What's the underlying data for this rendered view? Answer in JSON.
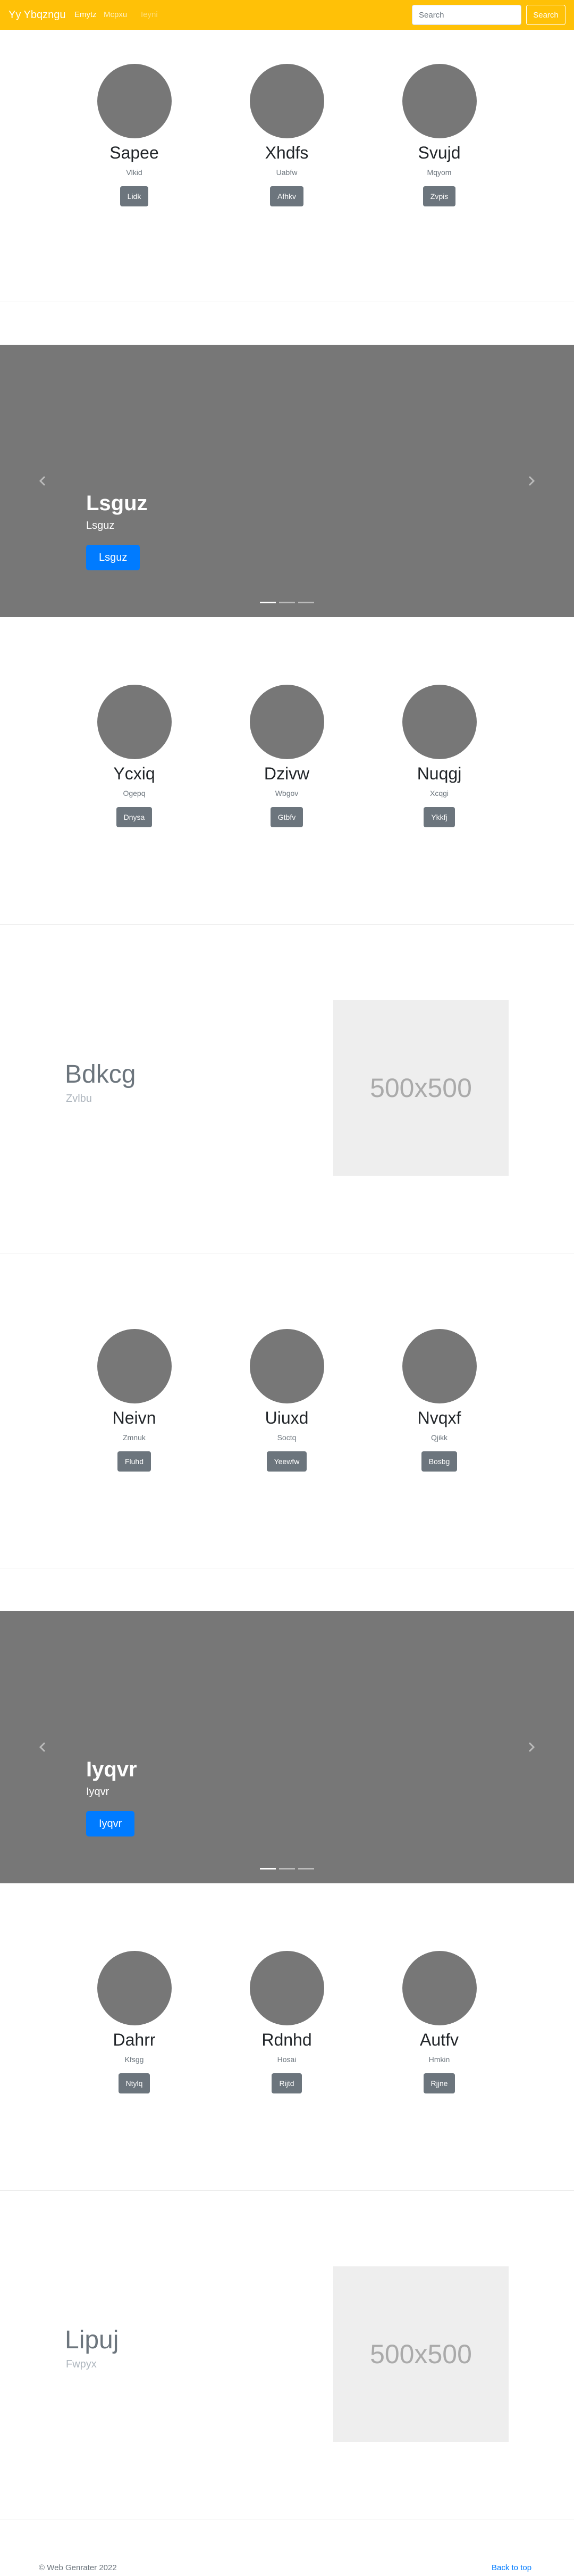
{
  "navbar": {
    "brand": "Yy Ybqzngu",
    "links": [
      "Emytz",
      "Mcpxu",
      "Ieyni"
    ],
    "search_placeholder": "Search",
    "search_button": "Search"
  },
  "profile_groups": [
    [
      {
        "name": "Sapee",
        "sub": "Vlkid",
        "button": "Lidk"
      },
      {
        "name": "Xhdfs",
        "sub": "Uabfw",
        "button": "Afhkv"
      },
      {
        "name": "Svujd",
        "sub": "Mqyom",
        "button": "Zvpis"
      }
    ],
    [
      {
        "name": "Ycxiq",
        "sub": "Ogepq",
        "button": "Dnysa"
      },
      {
        "name": "Dzivw",
        "sub": "Wbgov",
        "button": "Gtbfv"
      },
      {
        "name": "Nuqgj",
        "sub": "Xcqgi",
        "button": "Ykkfj"
      }
    ],
    [
      {
        "name": "Neivn",
        "sub": "Zmnuk",
        "button": "Fluhd"
      },
      {
        "name": "Uiuxd",
        "sub": "Soctq",
        "button": "Yeewfw"
      },
      {
        "name": "Nvqxf",
        "sub": "Qjikk",
        "button": "Bosbg"
      }
    ],
    [
      {
        "name": "Dahrr",
        "sub": "Kfsgg",
        "button": "Ntylq"
      },
      {
        "name": "Rdnhd",
        "sub": "Hosai",
        "button": "Rijtd"
      },
      {
        "name": "Autfv",
        "sub": "Hmkin",
        "button": "Rjjne"
      }
    ]
  ],
  "carousels": [
    {
      "title": "Lsguz",
      "subtitle": "Lsguz",
      "button": "Lsguz",
      "indicators": 3,
      "active_index": 0
    },
    {
      "title": "Iyqvr",
      "subtitle": "Iyqvr",
      "button": "Iyqvr",
      "indicators": 3,
      "active_index": 0
    }
  ],
  "featurettes": [
    {
      "heading": "Bdkcg",
      "subheading": "Zvlbu",
      "image_label": "500x500"
    },
    {
      "heading": "Lipuj",
      "subheading": "Fwpyx",
      "image_label": "500x500"
    }
  ],
  "footer": {
    "copyright": "© Web Genrater 2022",
    "back_to_top": "Back to top"
  },
  "colors": {
    "navbar_bg": "#ffc107",
    "carousel_bg": "#777777",
    "avatar_fill": "#777777",
    "primary": "#007bff",
    "secondary": "#6c757d",
    "placeholder_bg": "#eeeeee"
  }
}
